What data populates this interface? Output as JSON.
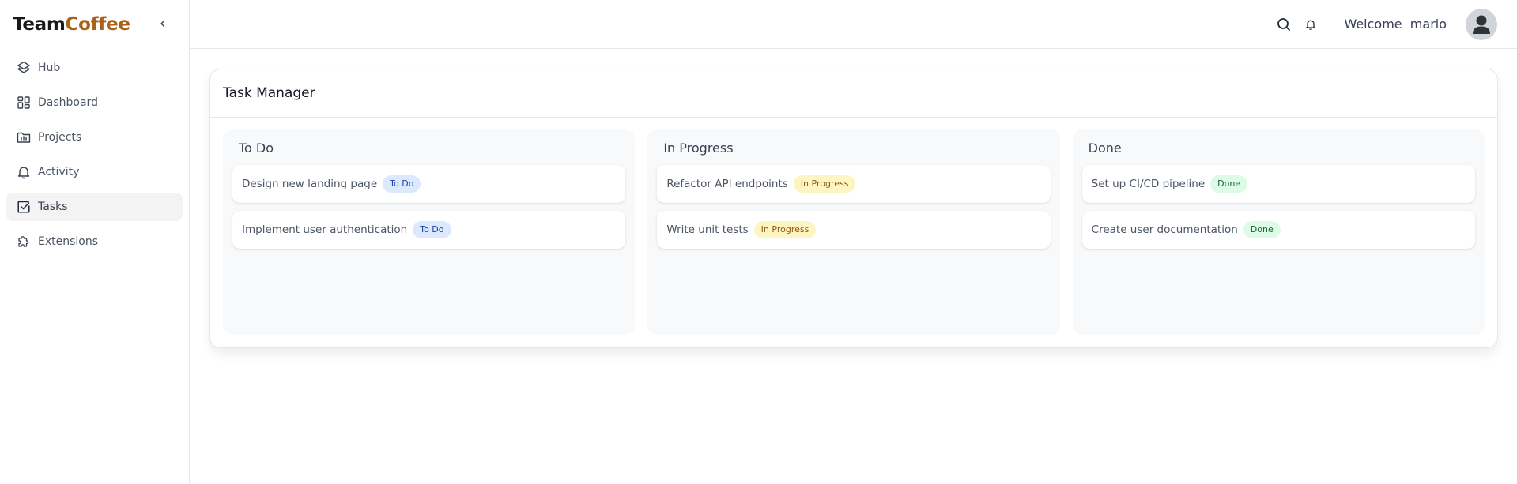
{
  "brand": {
    "part1": "Team",
    "part2": "Coffee"
  },
  "sidebar": {
    "collapse_icon": "chevron-left-icon",
    "items": [
      {
        "label": "Hub",
        "icon": "layers-icon",
        "active": false
      },
      {
        "label": "Dashboard",
        "icon": "dashboard-grid-icon",
        "active": false
      },
      {
        "label": "Projects",
        "icon": "folder-chart-icon",
        "active": false
      },
      {
        "label": "Activity",
        "icon": "bell-icon",
        "active": false
      },
      {
        "label": "Tasks",
        "icon": "checkbox-icon",
        "active": true
      },
      {
        "label": "Extensions",
        "icon": "puzzle-icon",
        "active": false
      }
    ]
  },
  "header": {
    "welcome_label": "Welcome",
    "username": "mario",
    "icons": [
      "search-icon",
      "bell-icon",
      "user-avatar-icon"
    ]
  },
  "card": {
    "title": "Task Manager",
    "columns": [
      {
        "title": "To Do",
        "tasks": [
          {
            "title": "Design new landing page",
            "status": "To Do"
          },
          {
            "title": "Implement user authentication",
            "status": "To Do"
          }
        ]
      },
      {
        "title": "In Progress",
        "tasks": [
          {
            "title": "Refactor API endpoints",
            "status": "In Progress"
          },
          {
            "title": "Write unit tests",
            "status": "In Progress"
          }
        ]
      },
      {
        "title": "Done",
        "tasks": [
          {
            "title": "Set up CI/CD pipeline",
            "status": "Done"
          },
          {
            "title": "Create user documentation",
            "status": "Done"
          }
        ]
      }
    ]
  },
  "colors": {
    "brand_accent": "#a8631a",
    "todo_badge_bg": "#dbe8fd",
    "todo_badge_text": "#1e40af",
    "progress_badge_bg": "#fdf6c3",
    "progress_badge_text": "#92570e",
    "done_badge_bg": "#dcfce7",
    "done_badge_text": "#166534"
  }
}
